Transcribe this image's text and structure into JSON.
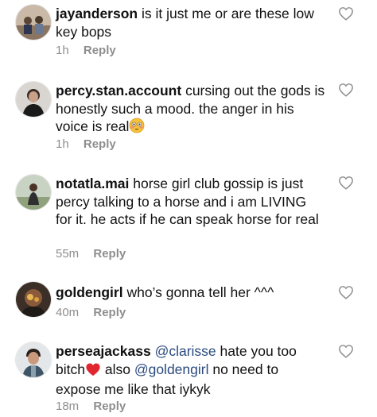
{
  "comments": [
    {
      "username": "jayanderson",
      "text": "is it just me or are these low key bops",
      "time": "1h",
      "reply": "Reply"
    },
    {
      "username": "percy.stan.account",
      "text": "cursing out the gods is honestly such a mood. the anger in his voice is real",
      "emoji": "flushed-face-emoji",
      "time": "1h",
      "reply": "Reply"
    },
    {
      "username": "notatla.mai",
      "text": "horse girl club gossip is just percy talking to a horse and i am LIVING for it. he acts if he can speak horse for real",
      "time": "55m",
      "reply": "Reply"
    },
    {
      "username": "goldengirl",
      "text": "who’s gonna tell her ^^^",
      "time": "40m",
      "reply": "Reply"
    },
    {
      "username": "perseajackass",
      "mention1": "@clarisse",
      "text_a": "hate you too bitch",
      "emoji": "red-heart-emoji",
      "text_b": "also",
      "mention2": "@goldengirl",
      "text_c": "no need to expose me like that iykyk",
      "time": "18m",
      "reply": "Reply"
    }
  ],
  "colors": {
    "text": "#111111",
    "meta": "#8e8e8e",
    "mention": "#2a4a7f",
    "heart_outline": "#8e8e8e"
  }
}
